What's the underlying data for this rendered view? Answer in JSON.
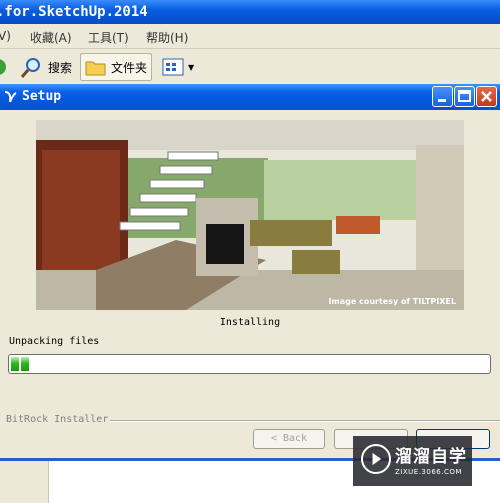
{
  "background_window": {
    "title": ".for.SketchUp.2014",
    "menu": [
      "V)",
      "收藏(A)",
      "工具(T)",
      "帮助(H)"
    ],
    "toolbar": {
      "search_label": "搜索",
      "folder_label": "文件夹"
    }
  },
  "dialog": {
    "title": "Setup",
    "image_credit": "Image courtesy of TILTPIXEL",
    "status": "Installing",
    "step": "Unpacking files",
    "progress_fraction": 0.04,
    "brand": "BitRock Installer",
    "buttons": {
      "back": "< Back",
      "next": "",
      "cancel": ""
    }
  },
  "watermark": {
    "name": "溜溜自学",
    "url": "ZIXUE.3066.COM"
  },
  "colors": {
    "titlebar": "#0558dc",
    "progress": "#2fb81f",
    "dialog_bg": "#ece9d8"
  }
}
